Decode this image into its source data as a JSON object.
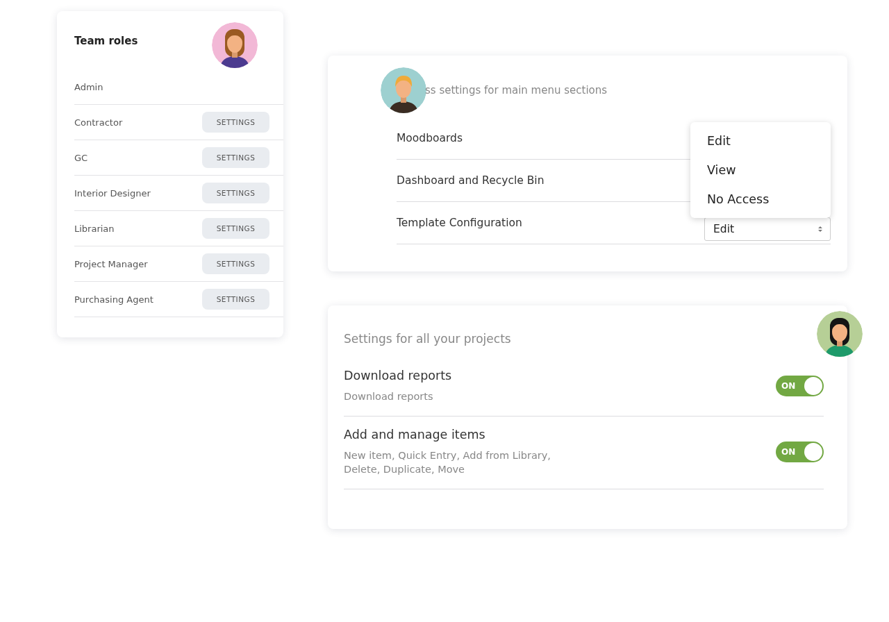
{
  "team_roles": {
    "title": "Team roles",
    "roles": [
      {
        "name": "Admin"
      },
      {
        "name": "Contractor",
        "button": "SETTINGS"
      },
      {
        "name": "GC",
        "button": "SETTINGS"
      },
      {
        "name": "Interior Designer",
        "button": "SETTINGS"
      },
      {
        "name": "Librarian",
        "button": "SETTINGS"
      },
      {
        "name": "Project Manager",
        "button": "SETTINGS"
      },
      {
        "name": "Purchasing Agent",
        "button": "SETTINGS"
      }
    ]
  },
  "access_settings": {
    "heading": "ss settings for main menu sections",
    "sections": [
      {
        "name": "Moodboards"
      },
      {
        "name": "Dashboard and Recycle Bin"
      },
      {
        "name": "Template Configuration",
        "value": "Edit"
      }
    ],
    "menu": [
      "Edit",
      "View",
      "No Access"
    ]
  },
  "project_settings": {
    "heading": "Settings for all your projects",
    "items": [
      {
        "title": "Download reports",
        "description": "Download reports",
        "on": true,
        "toggle_label": "ON"
      },
      {
        "title": "Add and manage items",
        "description": "New item, Quick Entry, Add from Library, Delete, Duplicate, Move",
        "on": true,
        "toggle_label": "ON"
      }
    ]
  }
}
